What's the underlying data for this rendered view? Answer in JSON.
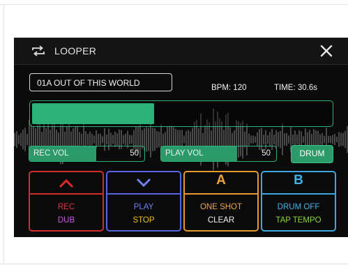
{
  "header": {
    "title": "LOOPER",
    "loop_icon": "loop-arrows-icon",
    "close_icon": "close-icon"
  },
  "song": {
    "name": "01A OUT OF THIS WORLD"
  },
  "info": {
    "bpm": "BPM: 120",
    "time": "TIME:  30.6s"
  },
  "progress": {
    "fraction": 0.41
  },
  "rec_vol": {
    "label": "REC VOL",
    "value": "50",
    "fraction": 0.58
  },
  "play_vol": {
    "label": "PLAY VOL",
    "value": "50",
    "fraction": 0.66
  },
  "drum": {
    "label": "DRUM"
  },
  "footswitches": [
    {
      "icon": "chevron-up-icon",
      "line1": "REC",
      "line2": "DUB",
      "color": "#d62b2b",
      "line1_color": "#d83a3a",
      "line2_color": "#c25adf"
    },
    {
      "icon": "chevron-down-icon",
      "line1": "PLAY",
      "line2": "STOP",
      "color": "#5566e0",
      "line1_color": "#6f7ff0",
      "line2_color": "#f0c020"
    },
    {
      "letter": "A",
      "line1": "ONE SHOT",
      "line2": "CLEAR",
      "color": "#e79a2e",
      "line1_color": "#f0a640",
      "line2_color": "#f2f2f2"
    },
    {
      "letter": "B",
      "line1": "DRUM OFF",
      "line2": "TAP TEMPO",
      "color": "#39a9e0",
      "line1_color": "#3fb4ea",
      "line2_color": "#8ed43c"
    }
  ],
  "colors": {
    "accent": "#2db07a",
    "background": "#0b0b0b"
  }
}
